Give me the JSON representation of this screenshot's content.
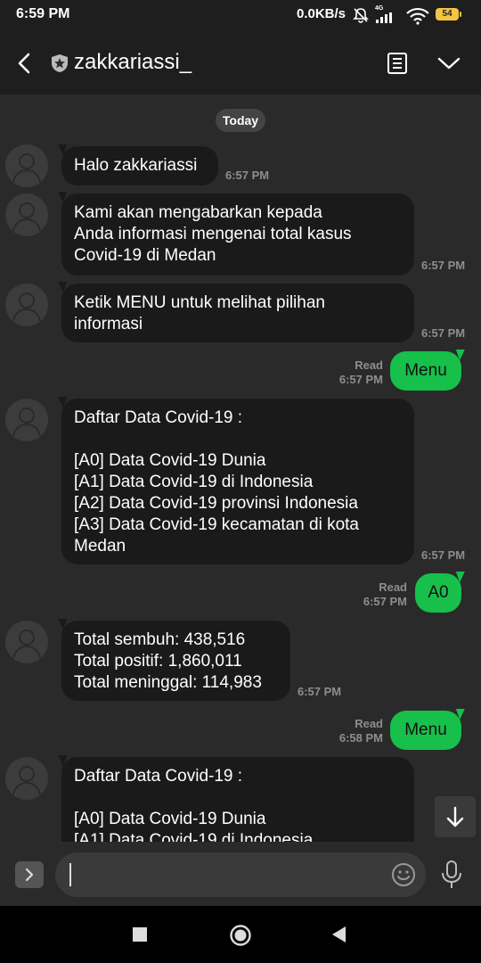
{
  "status_bar": {
    "time": "6:59 PM",
    "network_speed": "0.0KB/s",
    "network_type": "4G",
    "battery": "54"
  },
  "header": {
    "chat_name": "zakkariassi_"
  },
  "date_separator": "Today",
  "messages": [
    {
      "direction": "in",
      "text": "Halo zakkariassi",
      "time": "6:57 PM"
    },
    {
      "direction": "in",
      "text": "Kami akan mengabarkan kepada\nAnda informasi mengenai total kasus\nCovid-19 di Medan",
      "time": "6:57 PM"
    },
    {
      "direction": "in",
      "text": "Ketik MENU untuk melihat pilihan\ninformasi",
      "time": "6:57 PM"
    },
    {
      "direction": "out",
      "text": "Menu",
      "status": "Read",
      "time": "6:57 PM"
    },
    {
      "direction": "in",
      "text": "Daftar Data Covid-19 :\n\n[A0] Data Covid-19 Dunia\n[A1] Data Covid-19 di Indonesia\n[A2] Data Covid-19 provinsi Indonesia\n[A3] Data Covid-19 kecamatan di kota\nMedan",
      "time": "6:57 PM"
    },
    {
      "direction": "out",
      "text": "A0",
      "status": "Read",
      "time": "6:57 PM"
    },
    {
      "direction": "in",
      "text": "Total sembuh: 438,516\nTotal positif: 1,860,011\nTotal meninggal: 114,983",
      "time": "6:57 PM"
    },
    {
      "direction": "out",
      "text": "Menu",
      "status": "Read",
      "time": "6:58 PM"
    },
    {
      "direction": "in",
      "text": "Daftar Data Covid-19 :\n\n[A0] Data Covid-19 Dunia\n[A1] Data Covid-19 di Indonesia",
      "time": ""
    }
  ],
  "colors": {
    "outgoing_bubble": "#16c04a",
    "incoming_bubble": "#1a1a1a",
    "background": "#2a2a2a"
  },
  "icons": [
    "back-arrow-icon",
    "star-shield-icon",
    "notes-icon",
    "chevron-down-icon",
    "arrow-down-icon",
    "chevron-right-icon",
    "emoji-icon",
    "microphone-icon",
    "nav-square-icon",
    "nav-circle-icon",
    "nav-triangle-icon"
  ]
}
